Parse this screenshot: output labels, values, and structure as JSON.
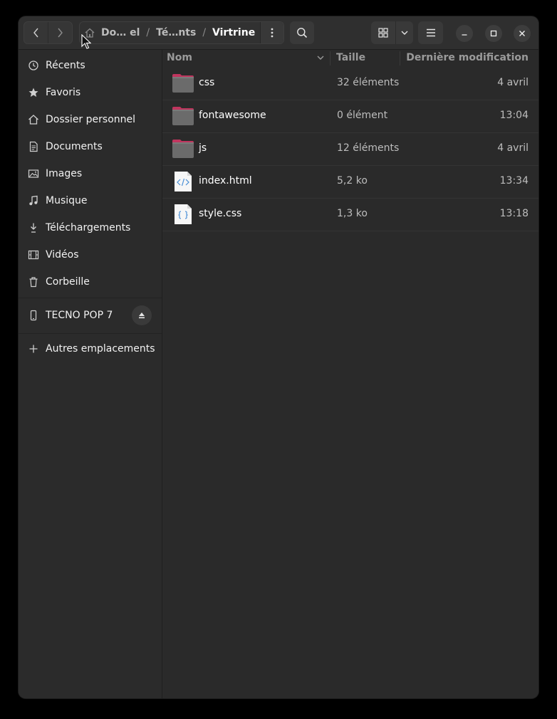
{
  "path": {
    "crumbs": [
      "Do…  el",
      "Té…nts"
    ],
    "separator": "/",
    "current": "Virtrine"
  },
  "sidebar": {
    "items": [
      {
        "label": "Récents",
        "icon": "clock-icon"
      },
      {
        "label": "Favoris",
        "icon": "star-icon"
      },
      {
        "label": "Dossier personnel",
        "icon": "home-icon"
      },
      {
        "label": "Documents",
        "icon": "document-icon"
      },
      {
        "label": "Images",
        "icon": "image-icon"
      },
      {
        "label": "Musique",
        "icon": "music-icon"
      },
      {
        "label": "Téléchargements",
        "icon": "download-icon"
      },
      {
        "label": "Vidéos",
        "icon": "video-icon"
      },
      {
        "label": "Corbeille",
        "icon": "trash-icon"
      }
    ],
    "device": {
      "label": "TECNO POP 7",
      "icon": "phone-icon"
    },
    "other_locations": {
      "label": "Autres emplacements",
      "icon": "plus-icon"
    }
  },
  "columns": {
    "name": "Nom",
    "size": "Taille",
    "modified": "Dernière modification"
  },
  "files": [
    {
      "name": "css",
      "size": "32 éléments",
      "modified": "4 avril",
      "type": "folder",
      "icon": "folder-icon"
    },
    {
      "name": "fontawesome",
      "size": "0 élément",
      "modified": "13:04",
      "type": "folder",
      "icon": "folder-icon"
    },
    {
      "name": "js",
      "size": "12 éléments",
      "modified": "4 avril",
      "type": "folder",
      "icon": "folder-icon"
    },
    {
      "name": "index.html",
      "size": "5,2 ko",
      "modified": "13:34",
      "type": "html",
      "icon": "html-file-icon"
    },
    {
      "name": "style.css",
      "size": "1,3 ko",
      "modified": "13:18",
      "type": "css",
      "icon": "css-file-icon"
    }
  ],
  "colors": {
    "window_bg": "#2a2a2a",
    "folder_body": "#6b6b6b",
    "folder_tab": "#c0355e",
    "accent_orange": "#e95420"
  }
}
